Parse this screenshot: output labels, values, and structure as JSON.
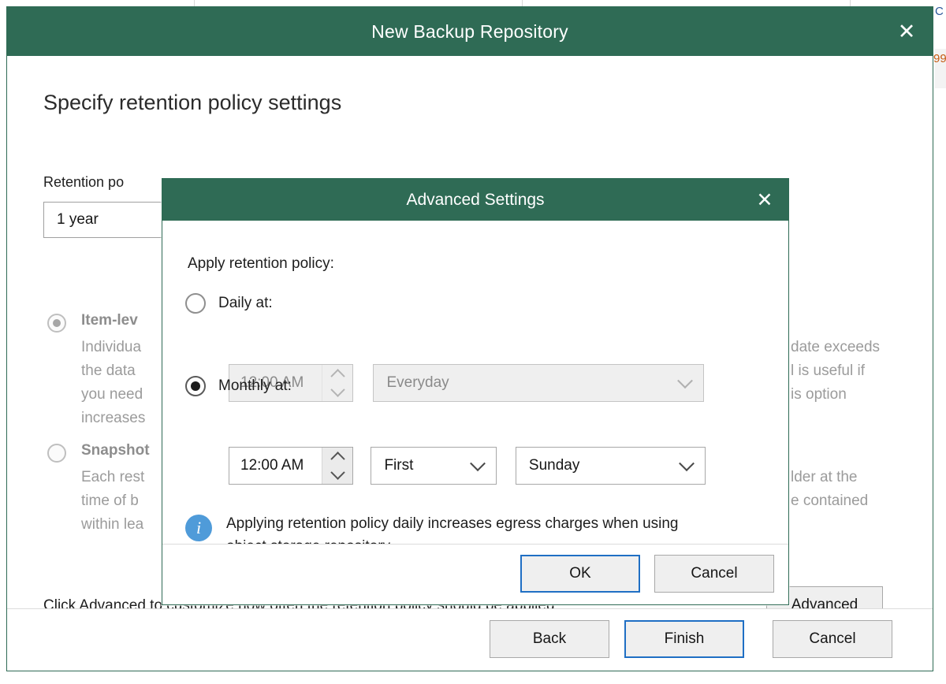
{
  "backdrop": {
    "text_fragment": "C",
    "number_fragment": "99"
  },
  "wizard": {
    "title": "New Backup Repository",
    "close_icon": "close-icon",
    "heading": "Specify retention policy settings",
    "retention_label": "Retention po",
    "retention_value": "1 year",
    "options": [
      {
        "title": "Item-lev",
        "desc_left": "Individua\nthe data\nyou need\nincreases",
        "desc_right": "date exceeds\nl is useful if\nis option",
        "selected": true
      },
      {
        "title": "Snapshot",
        "desc_left": "Each rest\ntime of b\nwithin lea",
        "desc_right": "lder at the\ne contained",
        "selected": false
      }
    ],
    "advanced_hint": "Click Advanced to customize how often the retention policy should be applied",
    "advanced_button": "Advanced",
    "footer": {
      "back": "Back",
      "finish": "Finish",
      "cancel": "Cancel"
    }
  },
  "modal": {
    "title": "Advanced Settings",
    "close_icon": "close-icon",
    "apply_label": "Apply retention policy:",
    "daily": {
      "label": "Daily at:",
      "selected": false,
      "time": "12:00 AM",
      "frequency": "Everyday"
    },
    "monthly": {
      "label": "Monthly at:",
      "selected": true,
      "time": "12:00 AM",
      "ordinal": "First",
      "weekday": "Sunday"
    },
    "info": {
      "icon": "info-icon",
      "text": "Applying retention policy daily increases egress charges when using object storage repository."
    },
    "footer": {
      "ok": "OK",
      "cancel": "Cancel"
    }
  },
  "colors": {
    "title_green": "#2F6B55",
    "focus_blue": "#1F6FC4",
    "info_blue": "#4F9BD9",
    "disabled_gray": "#EFEFEF"
  }
}
